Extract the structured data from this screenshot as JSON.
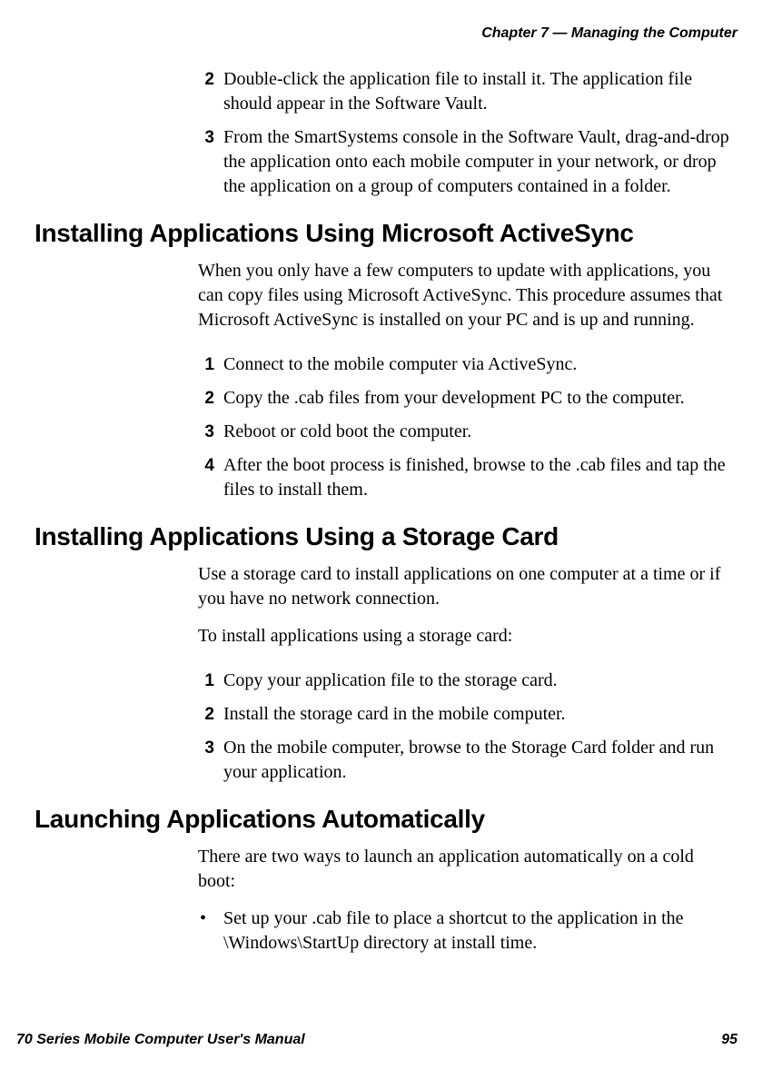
{
  "chapter_header": "Chapter 7 — Managing the Computer",
  "initial_steps": [
    {
      "num": "2",
      "text": "Double-click the application file to install it. The application file should appear in the Software Vault."
    },
    {
      "num": "3",
      "text": "From the SmartSystems console in the Software Vault, drag-and-drop the application onto each mobile computer in your network, or drop the application on a group of computers contained in a folder."
    }
  ],
  "section1": {
    "heading": "Installing Applications Using Microsoft ActiveSync",
    "para": "When you only have a few computers to update with applications, you can copy files using Microsoft ActiveSync. This procedure assumes that Microsoft ActiveSync is installed on your PC and is up and running.",
    "steps": [
      {
        "num": "1",
        "text": "Connect to the mobile computer via ActiveSync."
      },
      {
        "num": "2",
        "text": "Copy the .cab files from your development PC to the computer."
      },
      {
        "num": "3",
        "text": "Reboot or cold boot the computer."
      },
      {
        "num": "4",
        "text": "After the boot process is finished, browse to the .cab files and tap the files to install them."
      }
    ]
  },
  "section2": {
    "heading": "Installing Applications Using a Storage Card",
    "para1": "Use a storage card to install applications on one computer at a time or if you have no network connection.",
    "para2": "To install applications using a storage card:",
    "steps": [
      {
        "num": "1",
        "text": "Copy your application file to the storage card."
      },
      {
        "num": "2",
        "text": "Install the storage card in the mobile computer."
      },
      {
        "num": "3",
        "text": "On the mobile computer, browse to the Storage Card folder and run your application."
      }
    ]
  },
  "section3": {
    "heading": "Launching Applications Automatically",
    "para": "There are two ways to launch an application automatically on a cold boot:",
    "bullets": [
      {
        "text": "Set up your .cab file to place a shortcut to the application in the \\Windows\\StartUp directory at install time."
      }
    ]
  },
  "footer": {
    "left": "70 Series Mobile Computer User's Manual",
    "right": "95"
  }
}
